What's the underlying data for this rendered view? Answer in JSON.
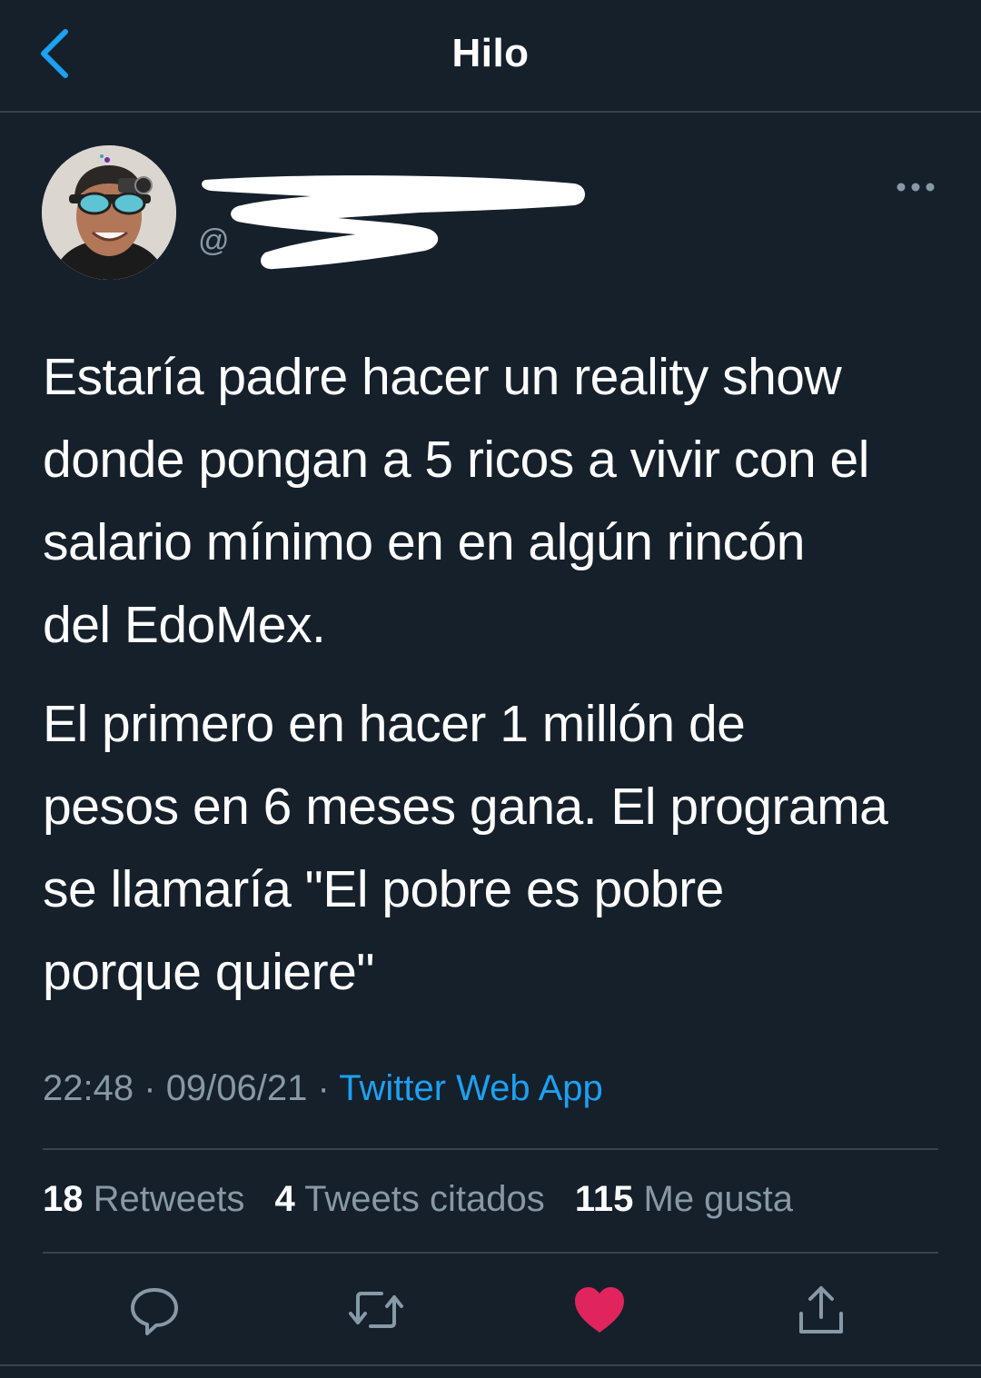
{
  "header": {
    "title": "Hilo"
  },
  "author": {
    "handle_prefix": "@"
  },
  "tweet": {
    "paragraphs": [
      "Estaría padre hacer un reality show\ndonde pongan a 5 ricos a vivir con el\nsalario mínimo en en algún rincón\ndel EdoMex.",
      "El primero en hacer 1 millón de\npesos en 6 meses gana. El programa\nse llamaría \"El pobre es pobre\nporque quiere\""
    ],
    "time": "22:48",
    "date": "09/06/21",
    "separator": "·",
    "source": "Twitter Web App"
  },
  "stats": {
    "retweets": {
      "count": "18",
      "label": "Retweets"
    },
    "quotes": {
      "count": "4",
      "label": "Tweets citados"
    },
    "likes": {
      "count": "115",
      "label": "Me gusta"
    }
  },
  "icons": {
    "back": "chevron-left-icon",
    "more": "more-horizontal-icon",
    "reply": "reply-icon",
    "retweet": "retweet-icon",
    "like": "heart-filled-icon",
    "share": "share-icon"
  },
  "colors": {
    "background": "#15202b",
    "accent": "#1da1f2",
    "like": "#e0245e",
    "muted": "#8899a6",
    "border": "#38444d"
  }
}
